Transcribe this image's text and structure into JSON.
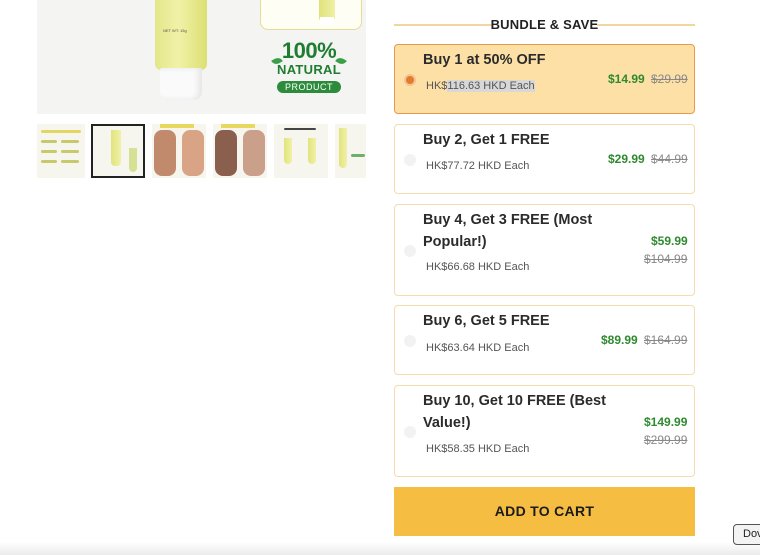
{
  "gallery": {
    "badge": {
      "percent": "100%",
      "natural": "NATURAL",
      "product": "PRODUCT"
    },
    "tube_label": "NET WT: 15g"
  },
  "bundle": {
    "title": "BUNDLE & SAVE",
    "options": [
      {
        "title": "Buy 1 at 50% OFF",
        "sub_prefix": "HK$",
        "sub_highlight": "116.63 HKD Each",
        "price": "$14.99",
        "old_price": "$29.99",
        "selected": true
      },
      {
        "title": "Buy 2, Get 1 FREE",
        "sub": "HK$77.72 HKD Each",
        "price": "$29.99",
        "old_price": "$44.99",
        "selected": false
      },
      {
        "title_line1": "Buy 4, Get 3 FREE (Most",
        "title_line2": "Popular!)",
        "sub": "HK$66.68 HKD Each",
        "price": "$59.99",
        "old_price": "$104.99",
        "selected": false
      },
      {
        "title": "Buy 6, Get 5 FREE",
        "sub": "HK$63.64 HKD Each",
        "price": "$89.99",
        "old_price": "$164.99",
        "selected": false
      },
      {
        "title_line1": "Buy 10, Get 10 FREE (Best",
        "title_line2": "Value!)",
        "sub": "HK$58.35 HKD Each",
        "price": "$149.99",
        "old_price": "$299.99",
        "selected": false
      }
    ]
  },
  "cart": {
    "label": "ADD TO CART"
  },
  "download_chip": {
    "label": "Dov"
  },
  "colors": {
    "accent_button": "#f5bd42",
    "selected_bg": "#fde0a6",
    "selected_border": "#e79a4a",
    "price_green": "#2f8a2f",
    "badge_green": "#1e7d30"
  }
}
